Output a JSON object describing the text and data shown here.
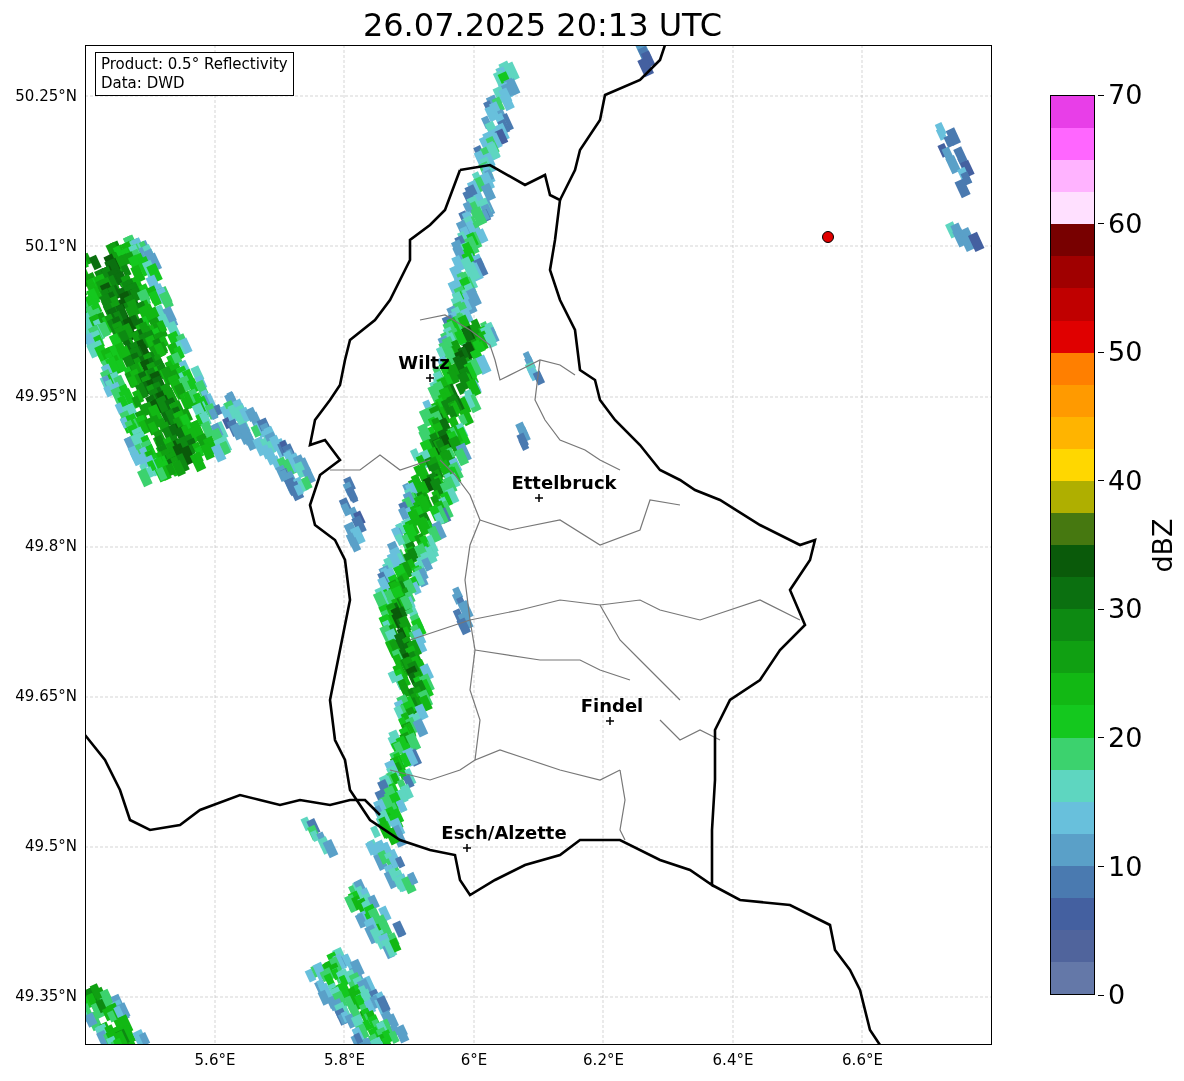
{
  "title": "26.07.2025 20:13 UTC",
  "legend": [
    "Product: 0.5° Reflectivity",
    "Data: DWD"
  ],
  "y_ticks": [
    "50.25°N",
    "50.1°N",
    "49.95°N",
    "49.8°N",
    "49.65°N",
    "49.5°N",
    "49.35°N"
  ],
  "x_ticks": [
    "5.6°E",
    "5.8°E",
    "6°E",
    "6.2°E",
    "6.4°E",
    "6.6°E"
  ],
  "cities": [
    {
      "name": "Wiltz"
    },
    {
      "name": "Ettelbruck"
    },
    {
      "name": "Findel"
    },
    {
      "name": "Esch/Alzette"
    }
  ],
  "colorbar": {
    "label": "dBZ",
    "ticks": [
      "70",
      "60",
      "50",
      "40",
      "30",
      "20",
      "10",
      "0"
    ],
    "bands": [
      {
        "color": "#e83ee8"
      },
      {
        "color": "#ff66ff"
      },
      {
        "color": "#ffb3ff"
      },
      {
        "color": "#ffe0ff"
      },
      {
        "color": "#780000"
      },
      {
        "color": "#a00000"
      },
      {
        "color": "#c00000"
      },
      {
        "color": "#e00000"
      },
      {
        "color": "#ff7f00"
      },
      {
        "color": "#ff9a00"
      },
      {
        "color": "#ffb400"
      },
      {
        "color": "#ffd700"
      },
      {
        "color": "#afaf00"
      },
      {
        "color": "#467810"
      },
      {
        "color": "#0a5a0a"
      },
      {
        "color": "#0b7010"
      },
      {
        "color": "#0d8a12"
      },
      {
        "color": "#10a012"
      },
      {
        "color": "#12b814"
      },
      {
        "color": "#14c81e"
      },
      {
        "color": "#3cd26e"
      },
      {
        "color": "#5ed6c0"
      },
      {
        "color": "#68c0dc"
      },
      {
        "color": "#5aa0c8"
      },
      {
        "color": "#4a7ab0"
      },
      {
        "color": "#4460a0"
      },
      {
        "color": "#50649c"
      },
      {
        "color": "#6478a8"
      }
    ]
  }
}
